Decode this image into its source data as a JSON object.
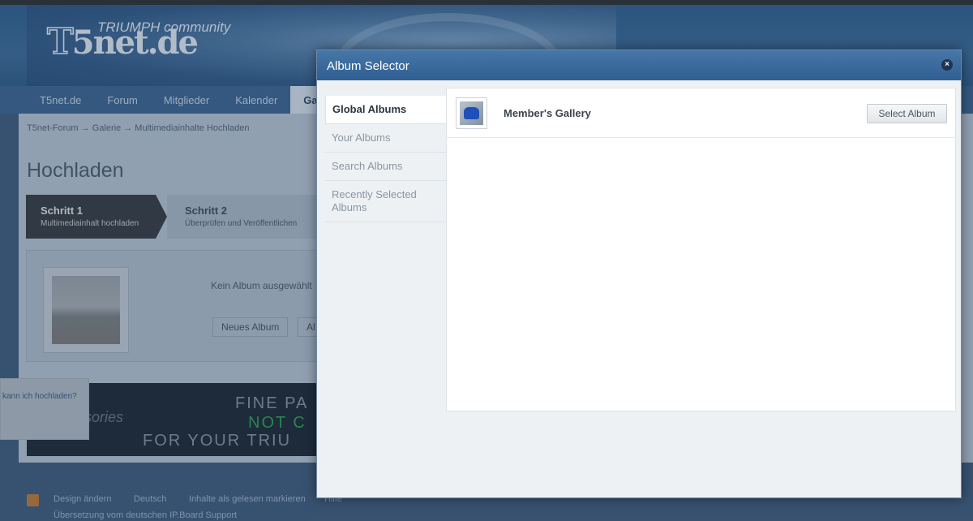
{
  "background": {
    "logo": {
      "sub": "TRIUMPH community",
      "main_prefix": "T",
      "main_rest": "5net.de"
    },
    "nav": [
      "T5net.de",
      "Forum",
      "Mitglieder",
      "Kalender",
      "Ga"
    ],
    "breadcrumb": [
      "T5net-Forum",
      "→",
      "Galerie",
      "→",
      "Multimediainhalte Hochladen"
    ],
    "page_title": "Hochladen",
    "steps": [
      {
        "title": "Schritt 1",
        "sub": "Multimediainhalt hochladen"
      },
      {
        "title": "Schritt 2",
        "sub": "Überprüfen und Veröffentlichen"
      }
    ],
    "no_album_text": "Kein Album ausgewählt",
    "new_album_btn": "Neues Album",
    "album_btn_partial": "Al",
    "banner": {
      "line1": "FINE PA",
      "line2": "NOT C",
      "line3": "FOR YOUR TRIU",
      "script": "ssories"
    },
    "help_text": "kann ich hochladen?",
    "footer": {
      "links": [
        "Design ändern",
        "Deutsch",
        "Inhalte als gelesen markieren",
        "Hilfe"
      ],
      "credit": "Übersetzung vom deutschen IP.Board Support"
    }
  },
  "modal": {
    "title": "Album Selector",
    "close_symbol": "×",
    "tabs": [
      "Global Albums",
      "Your Albums",
      "Search Albums",
      "Recently Selected Albums"
    ],
    "active_tab": "Global Albums",
    "albums": [
      {
        "name": "Member's Gallery",
        "button": "Select Album"
      }
    ]
  },
  "colors": {
    "modal_header": "#3a6a9c",
    "nav_bg": "#3a6390",
    "page_bg": "#bac7d5"
  }
}
